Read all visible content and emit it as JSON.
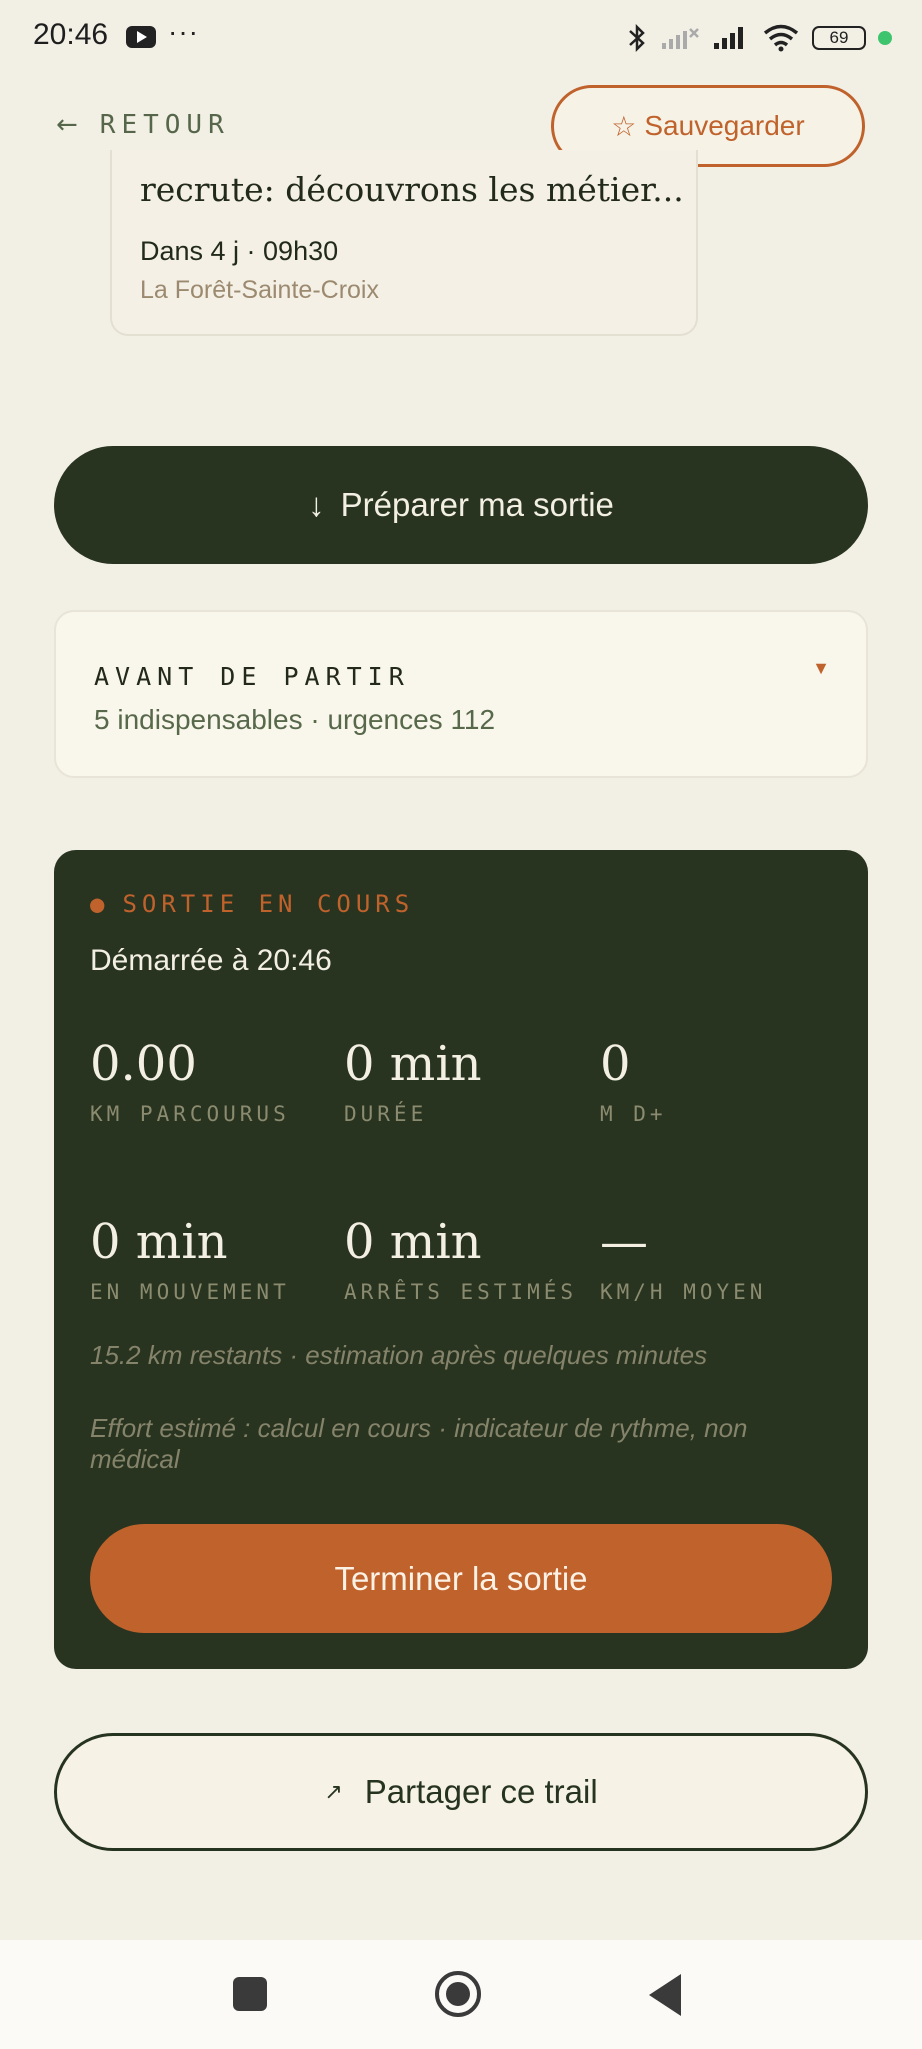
{
  "status_bar": {
    "time": "20:46",
    "more": "···",
    "battery": "69",
    "icons": [
      "youtube-icon",
      "bluetooth-icon",
      "no-signal-icon",
      "signal-icon",
      "wifi-icon",
      "battery-icon"
    ]
  },
  "header": {
    "back_arrow": "←",
    "back_label": "RETOUR",
    "save_star": "☆",
    "save_label": "Sauvegarder"
  },
  "event": {
    "title": "recrute: découvrons les métier...",
    "when": "Dans 4 j · 09h30",
    "place": "La Forêt-Sainte-Croix"
  },
  "prepare": {
    "icon": "↓",
    "label": "Préparer ma sortie"
  },
  "before": {
    "title": "AVANT DE PARTIR",
    "subtitle": "5 indispensables · urgences 112",
    "caret": "▼"
  },
  "current": {
    "dot": "●",
    "label": "SORTIE EN COURS",
    "started": "Démarrée à 20:46",
    "stats": [
      {
        "value": "0.00",
        "label": "KM PARCOURUS"
      },
      {
        "value": "0 min",
        "label": "DURÉE"
      },
      {
        "value": "0",
        "label": "M D+"
      },
      {
        "value": "0 min",
        "label": "EN MOUVEMENT"
      },
      {
        "value": "0 min",
        "label": "ARRÊTS ESTIMÉS"
      },
      {
        "value": "—",
        "label": "KM/H MOYEN"
      }
    ],
    "remaining": "15.2 km restants · estimation après quelques minutes",
    "effort": "Effort estimé : calcul en cours · indicateur de rythme, non médical",
    "end_label": "Terminer la sortie"
  },
  "share": {
    "icon": "↗",
    "label": "Partager ce trail"
  },
  "colors": {
    "background": "#f2efe4",
    "dark_green": "#283420",
    "accent_orange": "#c0622c"
  }
}
